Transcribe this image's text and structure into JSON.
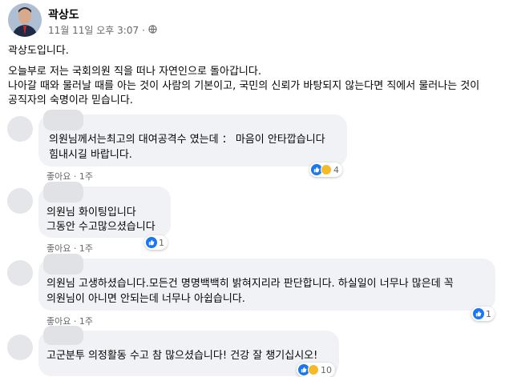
{
  "post": {
    "author": "곽상도",
    "timestamp": "11월 11일 오후 3:07",
    "visibility_dot": "·",
    "lines": [
      "곽상도입니다.",
      "오늘부로 저는 국회의원 직을 떠나 자연인으로 돌아갑니다.",
      "나아갈 때와 물러날 때를 아는 것이 사람의 기본이고, 국민의 신뢰가 바탕되지 않는다면 직에서 물러나는 것이",
      "공직자의 숙명이라 믿습니다."
    ]
  },
  "comments": [
    {
      "lines": [
        "의원님께서는최고의 대여공격수 였는데 ： 마음이 안타깝습니다",
        "힘내시길 바랍니다."
      ],
      "like_label": "좋아요",
      "age": "1주",
      "reaction_count": "4"
    },
    {
      "lines": [
        "의원님 화이팅입니다",
        "그동안 수고많으셨습니다"
      ],
      "like_label": "좋아요",
      "age": "1주",
      "reaction_count": "1"
    },
    {
      "lines": [
        "의원님 고생하셨습니다.모든건 명명백백히 밝혀지리라 판단합니다. 하실일이 너무나 많은데 꼭",
        "의원님이 아니면 안되는데 너무나 아쉽습니다."
      ],
      "like_label": "좋아요",
      "age": "1주",
      "reaction_count": "1"
    },
    {
      "lines": [
        "고군분투 의정활동 수고 참 많으셨습니다! 건강 잘 챙기십시오!"
      ],
      "reaction_count": "10"
    }
  ],
  "colors": {
    "bubble": "#f0f2f5",
    "like_blue": "#1877f2",
    "haha_yellow": "#f7b928",
    "meta_gray": "#65676b"
  },
  "icons": [
    "globe-icon",
    "like-reaction-icon",
    "haha-reaction-icon"
  ]
}
